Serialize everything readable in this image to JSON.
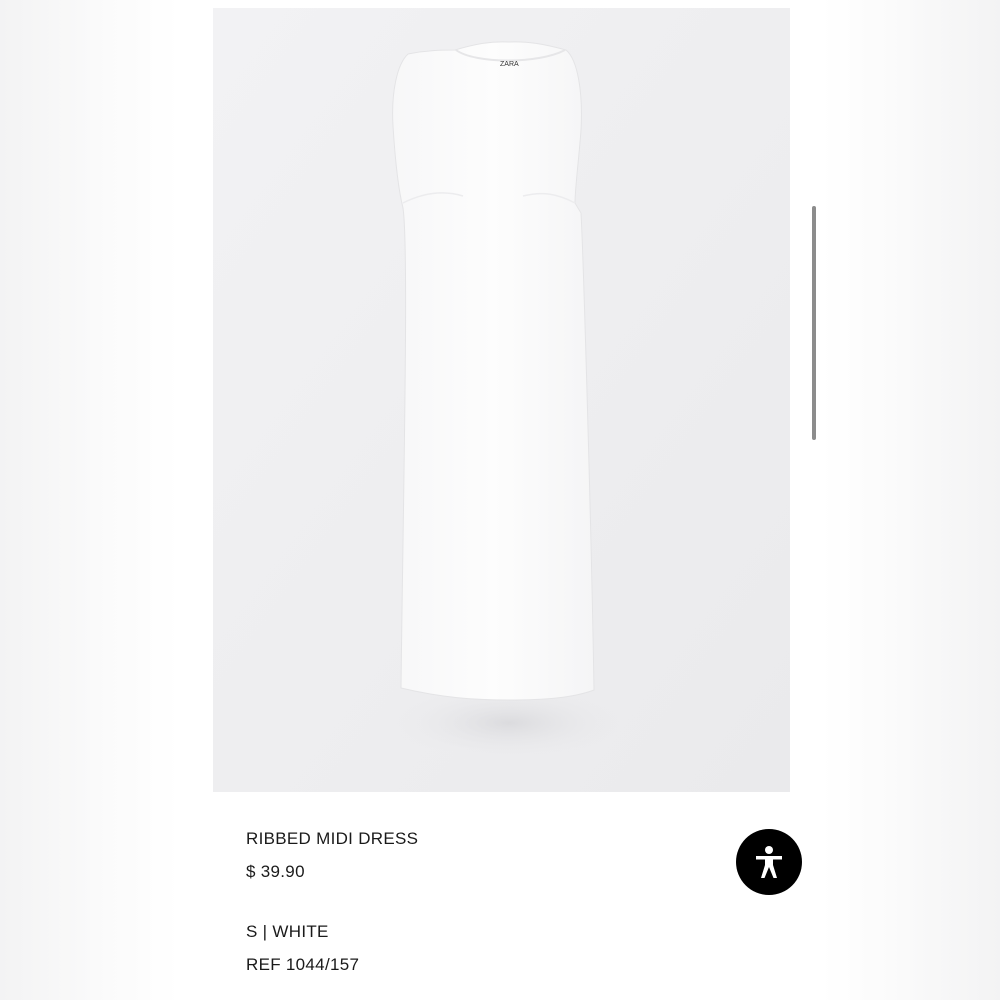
{
  "product": {
    "brand_logo": "ZARA",
    "name": "RIBBED MIDI DRESS",
    "price": "$ 39.90",
    "variant": "S | WHITE",
    "reference": "REF 1044/157",
    "image_alt": "White ribbed sleeveless midi dress laid flat"
  },
  "colors": {
    "background": "#ffffff",
    "image_background": "#efeff1",
    "dress": "#fbfbfb",
    "text": "#1a1a1a",
    "accessibility_button": "#000000",
    "scrollbar": "#8c8c8c"
  },
  "icons": {
    "accessibility": "accessibility-person-icon"
  }
}
